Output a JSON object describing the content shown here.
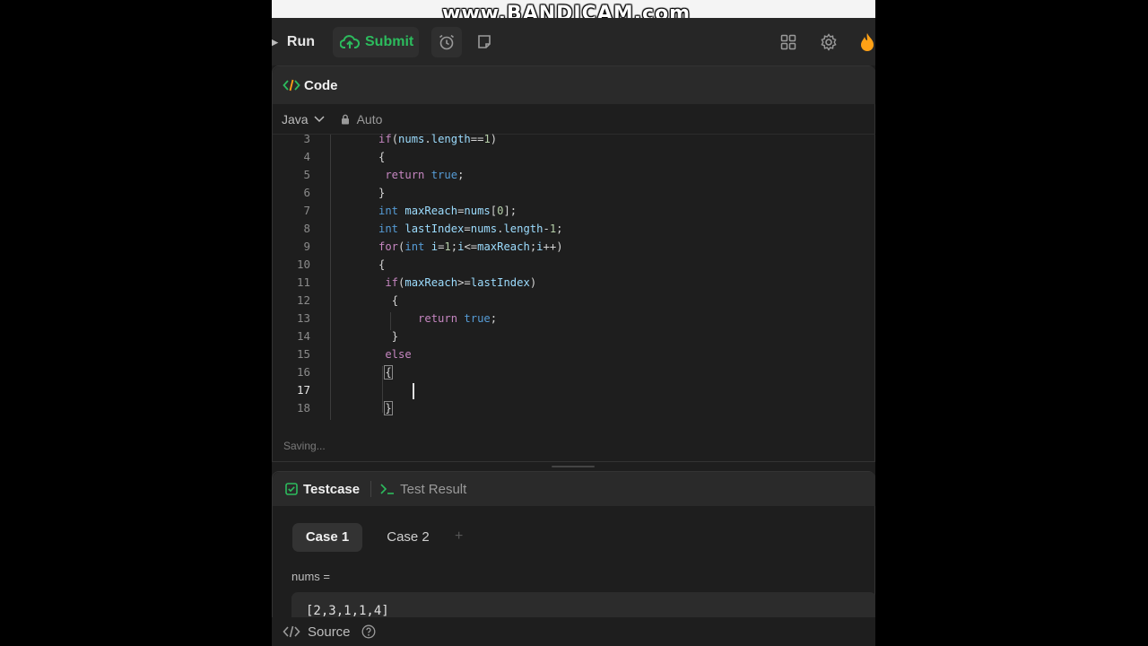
{
  "watermark": "www.BANDICAM.com",
  "toolbar": {
    "run_label": "Run",
    "submit_label": "Submit"
  },
  "code_panel": {
    "title": "Code",
    "language": "Java",
    "mode": "Auto",
    "status": "Saving..."
  },
  "editor": {
    "line_numbers": [
      "3",
      "4",
      "5",
      "6",
      "7",
      "8",
      "9",
      "10",
      "11",
      "12",
      "13",
      "14",
      "15",
      "16",
      "17",
      "18"
    ],
    "active_line": "17"
  },
  "test_panel": {
    "tab_testcase": "Testcase",
    "tab_result": "Test Result",
    "cases": [
      "Case 1",
      "Case 2"
    ],
    "add_case": "+",
    "var_name": "nums =",
    "var_value": "[2,3,1,1,4]"
  },
  "footer": {
    "source_label": "Source"
  },
  "colors": {
    "accent_green": "#2cbb5d",
    "fire_orange": "#ffa116"
  },
  "icons": [
    "caret-right-icon",
    "upload-cloud-icon",
    "alarm-clock-icon",
    "note-icon",
    "layout-grid-icon",
    "gear-icon",
    "fire-icon",
    "code-brackets-icon",
    "chevron-down-icon",
    "lock-icon",
    "checkbox-icon",
    "terminal-icon",
    "plus-icon",
    "help-icon"
  ]
}
